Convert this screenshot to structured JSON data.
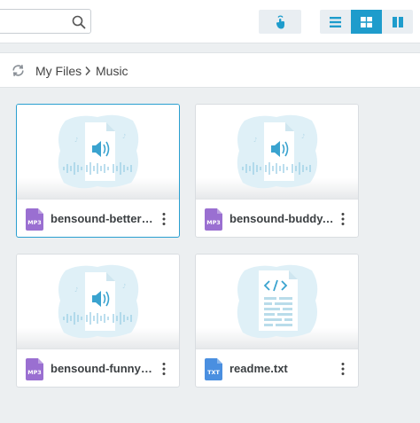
{
  "search": {
    "value": "",
    "placeholder": ""
  },
  "toolbar": {
    "touch_icon": "touch-gesture-icon",
    "view_modes": [
      {
        "icon": "list-view-icon",
        "active": false
      },
      {
        "icon": "grid-view-icon",
        "active": true
      },
      {
        "icon": "columns-view-icon",
        "active": false
      }
    ],
    "accent_color": "#1e9ccc"
  },
  "breadcrumb": {
    "refresh_icon": "refresh-icon",
    "root": "My Files",
    "current": "Music"
  },
  "files": [
    {
      "name": "bensound-betterd...",
      "type": "MP3",
      "thumbnail": "audio-file-icon",
      "badge_color": "#9a6fd1",
      "selected": true
    },
    {
      "name": "bensound-buddy....",
      "type": "MP3",
      "thumbnail": "audio-file-icon",
      "badge_color": "#9a6fd1",
      "selected": false
    },
    {
      "name": "bensound-funnys...",
      "type": "MP3",
      "thumbnail": "audio-file-icon",
      "badge_color": "#9a6fd1",
      "selected": false
    },
    {
      "name": "readme.txt",
      "type": "TXT",
      "thumbnail": "code-file-icon",
      "badge_color": "#4a8fe0",
      "selected": false
    }
  ]
}
